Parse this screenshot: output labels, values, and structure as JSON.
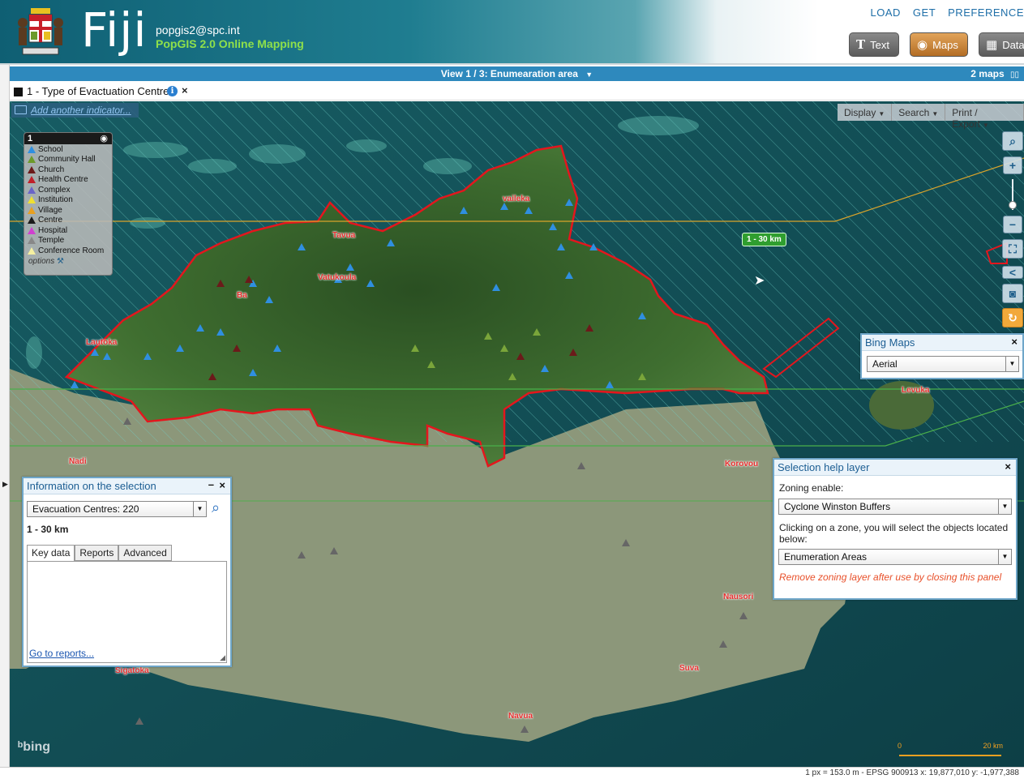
{
  "header": {
    "brand": "Fiji",
    "user_email": "popgis2@spc.int",
    "app_name": "PopGIS 2.0 Online Mapping",
    "top_links": [
      "LOAD",
      "GET",
      "PREFERENCE"
    ],
    "modes": {
      "text": "Text",
      "maps": "Maps",
      "data": "Data"
    }
  },
  "viewbar": {
    "title": "View 1 / 3: Enumearation area",
    "maps_count": "2 maps"
  },
  "indicator": {
    "title": "1 - Type of Evactuation Centre"
  },
  "map": {
    "add_indicator": "Add another indicator...",
    "toolbar": [
      "Display",
      "Search",
      "Print / Export"
    ],
    "buffer_label": "1 - 30 km",
    "bing_logo": "bing",
    "scale": {
      "start": "0",
      "end": "20 km"
    },
    "places": [
      "vaileka",
      "Tavua",
      "Vatukoula",
      "Ba",
      "Lautoka",
      "Nadi",
      "Levuka",
      "Korovou",
      "Nausori",
      "Sigatoka",
      "Suva",
      "Navua"
    ]
  },
  "legend": {
    "title": "1",
    "items": [
      {
        "label": "School",
        "color": "#2f8fe0"
      },
      {
        "label": "Community Hall",
        "color": "#6c9a2a"
      },
      {
        "label": "Church",
        "color": "#6b1a1a"
      },
      {
        "label": "Health Centre",
        "color": "#c0202a"
      },
      {
        "label": "Complex",
        "color": "#6a64c8"
      },
      {
        "label": "Institution",
        "color": "#f0e030"
      },
      {
        "label": "Village",
        "color": "#e8a020"
      },
      {
        "label": "Centre",
        "color": "#1a1a1a"
      },
      {
        "label": "Hospital",
        "color": "#d040d0"
      },
      {
        "label": "Temple",
        "color": "#888888"
      },
      {
        "label": "Conference Room",
        "color": "#f5f0a0"
      }
    ],
    "options": "options"
  },
  "bing_panel": {
    "title": "Bing Maps",
    "style": "Aerial"
  },
  "info_panel": {
    "title": "Information on the selection",
    "select_value": "Evacuation Centres: 220",
    "range": "1 - 30 km",
    "tabs": [
      "Key data",
      "Reports",
      "Advanced"
    ],
    "link": "Go to reports..."
  },
  "help_panel": {
    "title": "Selection help layer",
    "zoning_label": "Zoning enable:",
    "zoning_value": "Cyclone Winston Buffers",
    "instruction": "Clicking on a zone, you will select the objects located below:",
    "objects_value": "Enumeration Areas",
    "warning": "Remove zoning layer after use by closing this panel"
  },
  "status": "1 px = 153.0 m - EPSG 900913  x: 19,877,010   y: -1,977,388"
}
